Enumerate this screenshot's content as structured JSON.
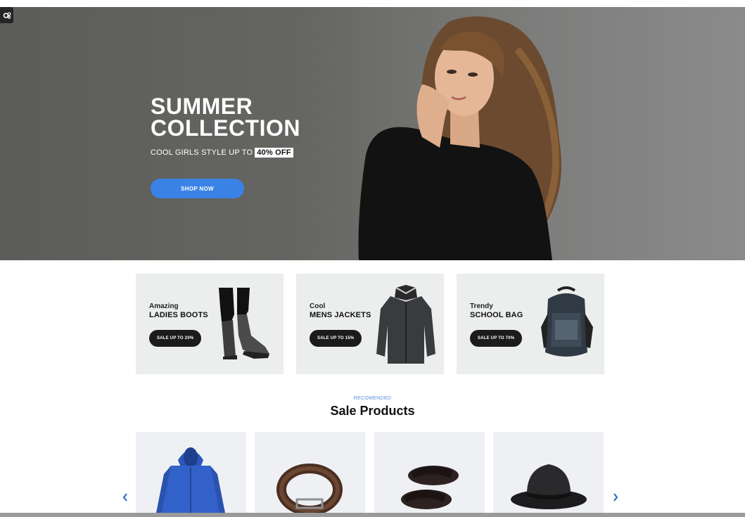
{
  "hero": {
    "title_line1": "SUMMER",
    "title_line2": "COLLECTION",
    "subtitle": "COOL GIRLS STYLE UP TO",
    "discount": "40% OFF",
    "cta": "SHOP NOW"
  },
  "promos": [
    {
      "tag": "Amazing",
      "name": "LADIES BOOTS",
      "sale": "SALE UP TO 20%",
      "icon": "boots-image"
    },
    {
      "tag": "Cool",
      "name": "MENS JACKETS",
      "sale": "SALE UP TO 15%",
      "icon": "jacket-image"
    },
    {
      "tag": "Trendy",
      "name": "SCHOOL BAG",
      "sale": "SALE UP TO 70%",
      "icon": "backpack-image"
    }
  ],
  "section": {
    "kicker": "RECOMENDED",
    "title": "Sale Products"
  },
  "products": [
    {
      "icon": "hoodie-image"
    },
    {
      "icon": "belt-image"
    },
    {
      "icon": "sandals-image"
    },
    {
      "icon": "hat-image"
    }
  ],
  "colors": {
    "accent": "#3b82e6",
    "hero_bg": "#6a6a68",
    "card_bg": "#eceeee",
    "pill_bg": "#1b1b1b"
  }
}
